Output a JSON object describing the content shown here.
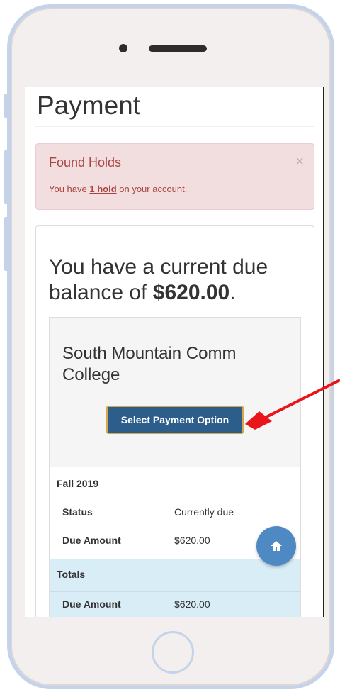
{
  "page": {
    "title": "Payment"
  },
  "alert": {
    "title": "Found Holds",
    "text_prefix": "You have ",
    "hold_count": "1 hold",
    "text_suffix": " on your account.",
    "close_glyph": "×"
  },
  "balance": {
    "prefix": "You have a current due balance of ",
    "amount": "$620.00",
    "suffix": "."
  },
  "school": {
    "name": "South Mountain Comm College",
    "button_label": "Select Payment Option"
  },
  "term": {
    "label": "Fall 2019",
    "rows": [
      {
        "label": "Status",
        "value": "Currently due"
      },
      {
        "label": "Due Amount",
        "value": "$620.00"
      }
    ]
  },
  "totals": {
    "label": "Totals",
    "rows": [
      {
        "label": "Due Amount",
        "value": "$620.00"
      }
    ]
  },
  "icons": {
    "fab": "home-icon"
  },
  "colors": {
    "accent": "#2c5d8b",
    "alert_bg": "#f2dede",
    "alert_text": "#a94442",
    "totals_bg": "#d9edf7",
    "arrow": "#e8151b"
  }
}
